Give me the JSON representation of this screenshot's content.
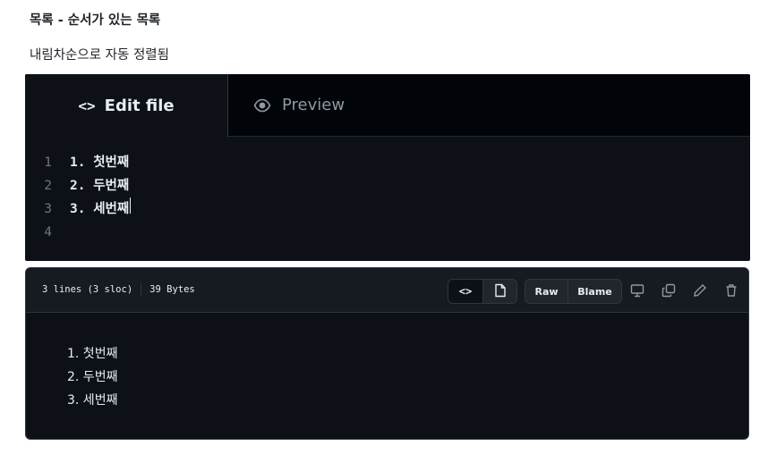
{
  "heading": "목록 - 순서가 있는 목록",
  "subheading": "내림차순으로 자동 정렬됨",
  "editor": {
    "tabs": {
      "edit_icon": "<>",
      "edit_label": "Edit file",
      "preview_label": "Preview"
    },
    "lines": [
      {
        "num": "1",
        "marker": "1. ",
        "text": "첫번째"
      },
      {
        "num": "2",
        "marker": "2. ",
        "text": "두번째"
      },
      {
        "num": "3",
        "marker": "3. ",
        "text": "세번째"
      },
      {
        "num": "4",
        "marker": "",
        "text": ""
      }
    ]
  },
  "file_view": {
    "lines_info": "3 lines (3 sloc)",
    "size_info": "39 Bytes",
    "code_button": "<>",
    "raw_label": "Raw",
    "blame_label": "Blame",
    "icons": [
      "code-icon",
      "file-icon",
      "desktop-icon",
      "copy-icon",
      "pencil-icon",
      "trash-icon"
    ],
    "rendered_items": [
      "1. 첫번째",
      "2. 두번째",
      "3. 세번째"
    ]
  },
  "colors": {
    "editor_bg": "#0d1117",
    "tabbar_bg": "#010409",
    "text_light": "#e6edf3",
    "text_muted": "#9198a1",
    "border": "#30363d"
  }
}
